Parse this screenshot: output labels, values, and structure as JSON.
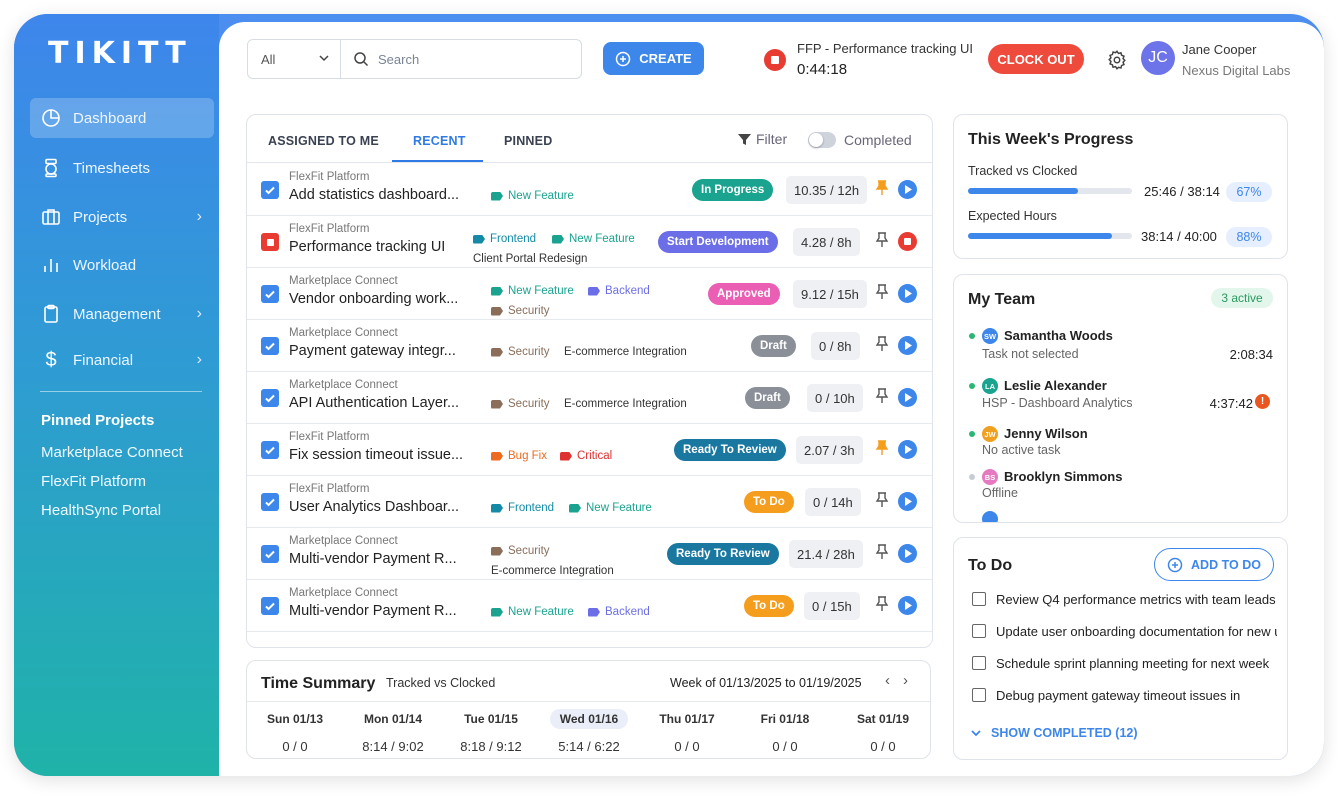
{
  "app": {
    "logo": "TIKITT"
  },
  "sidebar": {
    "items": [
      {
        "label": "Dashboard",
        "icon": "pie-chart-icon"
      },
      {
        "label": "Timesheets",
        "icon": "stopwatch-icon"
      },
      {
        "label": "Projects",
        "icon": "briefcase-icon"
      },
      {
        "label": "Workload",
        "icon": "bar-chart-icon"
      },
      {
        "label": "Management",
        "icon": "clipboard-icon"
      },
      {
        "label": "Financial",
        "icon": "dollar-icon"
      }
    ],
    "pinned_title": "Pinned Projects",
    "pinned": [
      "Marketplace Connect",
      "FlexFit Platform",
      "HealthSync Portal"
    ]
  },
  "topbar": {
    "scope_value": "All",
    "search_placeholder": "Search",
    "create_label": "CREATE",
    "timer_task": "FFP - Performance tracking UI",
    "timer_time": "0:44:18",
    "clockout_label": "CLOCK OUT",
    "user_initials": "JC",
    "user_name": "Jane Cooper",
    "user_org": "Nexus Digital Labs"
  },
  "tasks": {
    "tabs": [
      "ASSIGNED TO ME",
      "RECENT",
      "PINNED"
    ],
    "filter_label": "Filter",
    "completed_label": "Completed",
    "rows": [
      {
        "project": "FlexFit Platform",
        "name": "Add statistics dashboard...",
        "tags": [
          {
            "label": "New Feature",
            "color": "#1aa38f"
          }
        ],
        "extra": "",
        "status": "In Progress",
        "status_color": "#1aa38f",
        "hours": "10.35 / 12h",
        "pinned": true,
        "running": false
      },
      {
        "project": "FlexFit Platform",
        "name": "Performance tracking UI",
        "tags": [
          {
            "label": "Frontend",
            "color": "#148aa6"
          },
          {
            "label": "New Feature",
            "color": "#1aa38f"
          }
        ],
        "extra": "Client Portal Redesign",
        "status": "Start Development",
        "status_color": "#6b6ee6",
        "hours": "4.28 / 8h",
        "pinned": false,
        "running": true
      },
      {
        "project": "Marketplace Connect",
        "name": "Vendor onboarding work...",
        "tags": [
          {
            "label": "New Feature",
            "color": "#1aa38f"
          },
          {
            "label": "Backend",
            "color": "#6b6ee6"
          },
          {
            "label": "Security",
            "color": "#8a6e5a"
          }
        ],
        "extra": "",
        "status": "Approved",
        "status_color": "#ea5fb3",
        "hours": "9.12 / 15h",
        "pinned": false,
        "running": false
      },
      {
        "project": "Marketplace Connect",
        "name": "Payment gateway integr...",
        "tags": [
          {
            "label": "Security",
            "color": "#8a6e5a"
          }
        ],
        "extra": "E-commerce Integration",
        "status": "Draft",
        "status_color": "#8a8f98",
        "hours": "0 / 8h",
        "pinned": false,
        "running": false
      },
      {
        "project": "Marketplace Connect",
        "name": "API Authentication Layer...",
        "tags": [
          {
            "label": "Security",
            "color": "#8a6e5a"
          }
        ],
        "extra": "E-commerce Integration",
        "status": "Draft",
        "status_color": "#8a8f98",
        "hours": "0 / 10h",
        "pinned": false,
        "running": false
      },
      {
        "project": "FlexFit Platform",
        "name": "Fix session timeout issue...",
        "tags": [
          {
            "label": "Bug Fix",
            "color": "#ee6a1e"
          },
          {
            "label": "Critical",
            "color": "#e03131"
          }
        ],
        "extra": "",
        "status": "Ready To Review",
        "status_color": "#1a78a0",
        "hours": "2.07 / 3h",
        "pinned": true,
        "running": false
      },
      {
        "project": "FlexFit Platform",
        "name": "User Analytics Dashboar...",
        "tags": [
          {
            "label": "Frontend",
            "color": "#148aa6"
          },
          {
            "label": "New Feature",
            "color": "#1aa38f"
          }
        ],
        "extra": "",
        "status": "To Do",
        "status_color": "#f59d1c",
        "hours": "0 / 14h",
        "pinned": false,
        "running": false
      },
      {
        "project": "Marketplace Connect",
        "name": "Multi-vendor Payment R...",
        "tags": [
          {
            "label": "Security",
            "color": "#8a6e5a"
          }
        ],
        "extra": "E-commerce Integration",
        "status": "Ready To Review",
        "status_color": "#1a78a0",
        "hours": "21.4 / 28h",
        "pinned": false,
        "running": false
      },
      {
        "project": "Marketplace Connect",
        "name": "Multi-vendor Payment R...",
        "tags": [
          {
            "label": "New Feature",
            "color": "#1aa38f"
          },
          {
            "label": "Backend",
            "color": "#6b6ee6"
          }
        ],
        "extra": "",
        "status": "To Do",
        "status_color": "#f59d1c",
        "hours": "0 / 15h",
        "pinned": false,
        "running": false
      }
    ]
  },
  "time_summary": {
    "title": "Time Summary",
    "subtitle": "Tracked vs Clocked",
    "week": "Week of 01/13/2025 to 01/19/2025",
    "days": [
      {
        "label": "Sun 01/13",
        "value": "0 / 0"
      },
      {
        "label": "Mon 01/14",
        "value": "8:14 / 9:02"
      },
      {
        "label": "Tue 01/15",
        "value": "8:18 / 9:12"
      },
      {
        "label": "Wed 01/16",
        "value": "5:14 / 6:22"
      },
      {
        "label": "Thu 01/17",
        "value": "0 / 0"
      },
      {
        "label": "Fri 01/18",
        "value": "0 / 0"
      },
      {
        "label": "Sat 01/19",
        "value": "0 / 0"
      }
    ]
  },
  "progress": {
    "title": "This Week's Progress",
    "metrics": [
      {
        "label": "Tracked vs Clocked",
        "value": "25:46 / 38:14",
        "percent": "67%",
        "fraction": 0.67
      },
      {
        "label": "Expected Hours",
        "value": "38:14 / 40:00",
        "percent": "88%",
        "fraction": 0.88
      }
    ]
  },
  "team": {
    "title": "My Team",
    "badge": "3 active",
    "members": [
      {
        "initials": "SW",
        "name": "Samantha Woods",
        "task": "Task not selected",
        "time": "2:08:34",
        "status_color": "#2bb673",
        "avatar_color": "#3d86ea"
      },
      {
        "initials": "LA",
        "name": "Leslie Alexander",
        "task": "HSP - Dashboard Analytics",
        "time": "4:37:42",
        "status_color": "#2bb673",
        "avatar_color": "#1aa38f"
      },
      {
        "initials": "JW",
        "name": "Jenny Wilson",
        "task": "No active task",
        "time": "",
        "status_color": "#2bb673",
        "avatar_color": "#f0a020"
      },
      {
        "initials": "BS",
        "name": "Brooklyn Simmons",
        "task": "Offline",
        "time": "",
        "status_color": "#c8ccd3",
        "avatar_color": "#e67ac0"
      }
    ]
  },
  "todo": {
    "title": "To Do",
    "add_label": "ADD TO DO",
    "items": [
      "Review Q4 performance metrics with team leads",
      "Update user onboarding documentation for new u",
      "Schedule sprint planning meeting for next week",
      "Debug payment gateway timeout issues in"
    ],
    "show_completed": "SHOW COMPLETED (12)"
  }
}
